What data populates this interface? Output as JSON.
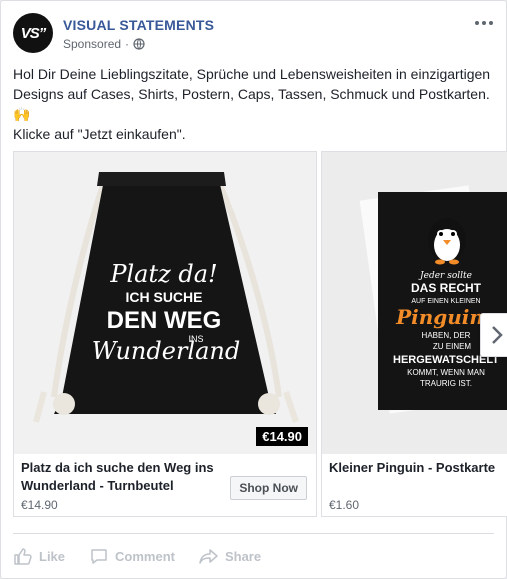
{
  "post": {
    "page_name": "VISUAL STATEMENTS",
    "avatar_text": "VS”",
    "sponsored": "Sponsored",
    "separator": "·",
    "text_line1": "Hol Dir Deine Lieblingszitate, Sprüche und Lebensweisheiten in einzigartigen Designs auf Cases, Shirts, Postern, Caps, Tassen, Schmuck und Postkarten. 🙌",
    "text_line2": "Klicke auf \"Jetzt einkaufen\"."
  },
  "cards": [
    {
      "title": "Platz da ich suche den Weg ins Wunderland - Turnbeutel",
      "price": "€14.90",
      "price_tag": "€14.90",
      "button": "Shop Now",
      "image_text": [
        "Platz da!",
        "ICH SUCHE",
        "DEN WEG",
        "INS",
        "Wunderland"
      ]
    },
    {
      "title": "Kleiner Pinguin - Postkarte",
      "price": "€1.60",
      "image_text": [
        "Jeder sollte",
        "DAS RECHT",
        "AUF EINEN KLEINEN",
        "Pinguin",
        "HABEN, DER",
        "ZU EINEM",
        "HERGEWATSCHELT",
        "KOMMT, WENN MAN",
        "TRAURIG IST."
      ]
    }
  ],
  "actions": {
    "like": "Like",
    "comment": "Comment",
    "share": "Share"
  },
  "colors": {
    "page_name": "#385898",
    "bag": "#151515",
    "card_dark": "#141414",
    "penguin_orange": "#f28c28",
    "action_gray": "#bec3c9"
  },
  "icons": {
    "globe": "globe-icon",
    "more": "more-options-icon",
    "next": "chevron-right-icon",
    "like": "thumbs-up-icon",
    "comment": "comment-bubble-icon",
    "share": "share-arrow-icon"
  }
}
